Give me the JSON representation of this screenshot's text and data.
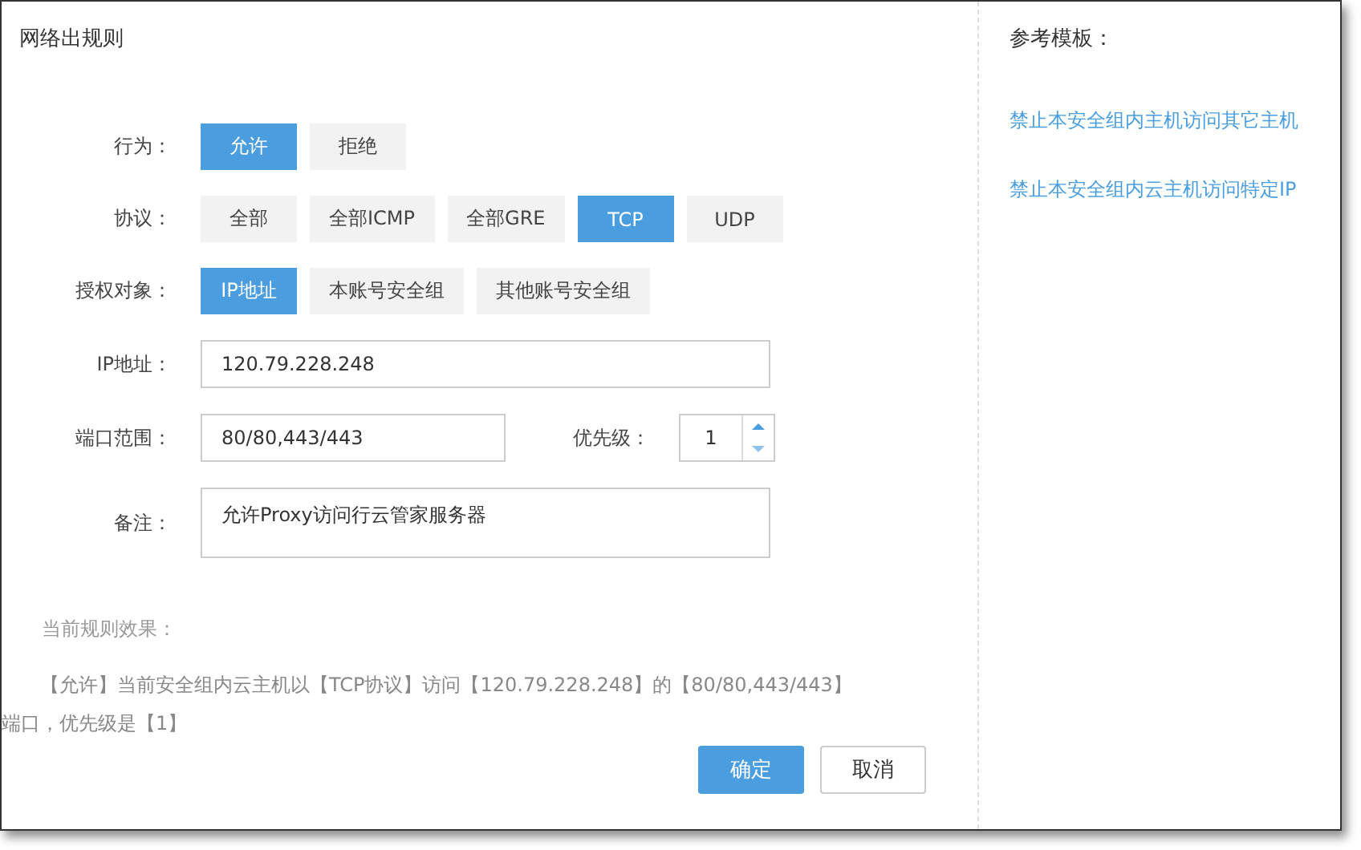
{
  "dialog": {
    "title": "网络出规则"
  },
  "form": {
    "rows": [
      {
        "kind": "options",
        "label": "行为：",
        "options": [
          {
            "label": "允许",
            "selected": true
          },
          {
            "label": "拒绝",
            "selected": false
          }
        ]
      },
      {
        "kind": "options",
        "label": "协议：",
        "options": [
          {
            "label": "全部",
            "selected": false
          },
          {
            "label": "全部ICMP",
            "selected": false
          },
          {
            "label": "全部GRE",
            "selected": false
          },
          {
            "label": "TCP",
            "selected": true
          },
          {
            "label": "UDP",
            "selected": false
          }
        ]
      },
      {
        "kind": "options",
        "label": "授权对象：",
        "options": [
          {
            "label": "IP地址",
            "selected": true
          },
          {
            "label": "本账号安全组",
            "selected": false
          },
          {
            "label": "其他账号安全组",
            "selected": false
          }
        ]
      },
      {
        "kind": "input",
        "label": "IP地址：",
        "value": "120.79.228.248"
      },
      {
        "kind": "port",
        "label": "端口范围：",
        "value": "80/80,443/443",
        "priority_label": "优先级：",
        "priority_value": "1"
      },
      {
        "kind": "textarea",
        "label": "备注：",
        "value": "允许Proxy访问行云管家服务器"
      }
    ]
  },
  "effect": {
    "label": "当前规则效果：",
    "text": "【允许】当前安全组内云主机以【TCP协议】访问【120.79.228.248】的【80/80,443/443】端口，优先级是【1】"
  },
  "buttons": [
    {
      "label": "确定",
      "kind": "primary"
    },
    {
      "label": "取消",
      "kind": "secondary"
    }
  ],
  "templates": {
    "title": "参考模板：",
    "links": [
      "禁止本安全组内主机访问其它主机",
      "禁止本安全组内云主机访问特定IP"
    ]
  }
}
